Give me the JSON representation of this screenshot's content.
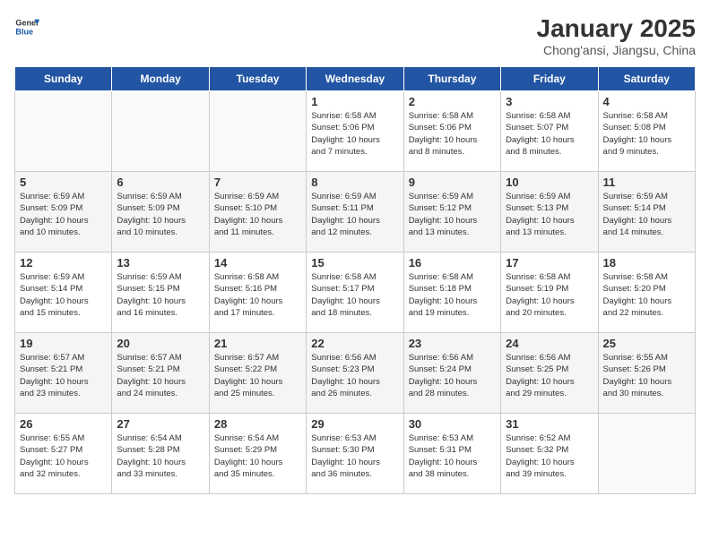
{
  "header": {
    "logo_line1": "General",
    "logo_line2": "Blue",
    "title": "January 2025",
    "subtitle": "Chong'ansi, Jiangsu, China"
  },
  "weekdays": [
    "Sunday",
    "Monday",
    "Tuesday",
    "Wednesday",
    "Thursday",
    "Friday",
    "Saturday"
  ],
  "weeks": [
    [
      {
        "day": "",
        "text": ""
      },
      {
        "day": "",
        "text": ""
      },
      {
        "day": "",
        "text": ""
      },
      {
        "day": "1",
        "text": "Sunrise: 6:58 AM\nSunset: 5:06 PM\nDaylight: 10 hours\nand 7 minutes."
      },
      {
        "day": "2",
        "text": "Sunrise: 6:58 AM\nSunset: 5:06 PM\nDaylight: 10 hours\nand 8 minutes."
      },
      {
        "day": "3",
        "text": "Sunrise: 6:58 AM\nSunset: 5:07 PM\nDaylight: 10 hours\nand 8 minutes."
      },
      {
        "day": "4",
        "text": "Sunrise: 6:58 AM\nSunset: 5:08 PM\nDaylight: 10 hours\nand 9 minutes."
      }
    ],
    [
      {
        "day": "5",
        "text": "Sunrise: 6:59 AM\nSunset: 5:09 PM\nDaylight: 10 hours\nand 10 minutes."
      },
      {
        "day": "6",
        "text": "Sunrise: 6:59 AM\nSunset: 5:09 PM\nDaylight: 10 hours\nand 10 minutes."
      },
      {
        "day": "7",
        "text": "Sunrise: 6:59 AM\nSunset: 5:10 PM\nDaylight: 10 hours\nand 11 minutes."
      },
      {
        "day": "8",
        "text": "Sunrise: 6:59 AM\nSunset: 5:11 PM\nDaylight: 10 hours\nand 12 minutes."
      },
      {
        "day": "9",
        "text": "Sunrise: 6:59 AM\nSunset: 5:12 PM\nDaylight: 10 hours\nand 13 minutes."
      },
      {
        "day": "10",
        "text": "Sunrise: 6:59 AM\nSunset: 5:13 PM\nDaylight: 10 hours\nand 13 minutes."
      },
      {
        "day": "11",
        "text": "Sunrise: 6:59 AM\nSunset: 5:14 PM\nDaylight: 10 hours\nand 14 minutes."
      }
    ],
    [
      {
        "day": "12",
        "text": "Sunrise: 6:59 AM\nSunset: 5:14 PM\nDaylight: 10 hours\nand 15 minutes."
      },
      {
        "day": "13",
        "text": "Sunrise: 6:59 AM\nSunset: 5:15 PM\nDaylight: 10 hours\nand 16 minutes."
      },
      {
        "day": "14",
        "text": "Sunrise: 6:58 AM\nSunset: 5:16 PM\nDaylight: 10 hours\nand 17 minutes."
      },
      {
        "day": "15",
        "text": "Sunrise: 6:58 AM\nSunset: 5:17 PM\nDaylight: 10 hours\nand 18 minutes."
      },
      {
        "day": "16",
        "text": "Sunrise: 6:58 AM\nSunset: 5:18 PM\nDaylight: 10 hours\nand 19 minutes."
      },
      {
        "day": "17",
        "text": "Sunrise: 6:58 AM\nSunset: 5:19 PM\nDaylight: 10 hours\nand 20 minutes."
      },
      {
        "day": "18",
        "text": "Sunrise: 6:58 AM\nSunset: 5:20 PM\nDaylight: 10 hours\nand 22 minutes."
      }
    ],
    [
      {
        "day": "19",
        "text": "Sunrise: 6:57 AM\nSunset: 5:21 PM\nDaylight: 10 hours\nand 23 minutes."
      },
      {
        "day": "20",
        "text": "Sunrise: 6:57 AM\nSunset: 5:21 PM\nDaylight: 10 hours\nand 24 minutes."
      },
      {
        "day": "21",
        "text": "Sunrise: 6:57 AM\nSunset: 5:22 PM\nDaylight: 10 hours\nand 25 minutes."
      },
      {
        "day": "22",
        "text": "Sunrise: 6:56 AM\nSunset: 5:23 PM\nDaylight: 10 hours\nand 26 minutes."
      },
      {
        "day": "23",
        "text": "Sunrise: 6:56 AM\nSunset: 5:24 PM\nDaylight: 10 hours\nand 28 minutes."
      },
      {
        "day": "24",
        "text": "Sunrise: 6:56 AM\nSunset: 5:25 PM\nDaylight: 10 hours\nand 29 minutes."
      },
      {
        "day": "25",
        "text": "Sunrise: 6:55 AM\nSunset: 5:26 PM\nDaylight: 10 hours\nand 30 minutes."
      }
    ],
    [
      {
        "day": "26",
        "text": "Sunrise: 6:55 AM\nSunset: 5:27 PM\nDaylight: 10 hours\nand 32 minutes."
      },
      {
        "day": "27",
        "text": "Sunrise: 6:54 AM\nSunset: 5:28 PM\nDaylight: 10 hours\nand 33 minutes."
      },
      {
        "day": "28",
        "text": "Sunrise: 6:54 AM\nSunset: 5:29 PM\nDaylight: 10 hours\nand 35 minutes."
      },
      {
        "day": "29",
        "text": "Sunrise: 6:53 AM\nSunset: 5:30 PM\nDaylight: 10 hours\nand 36 minutes."
      },
      {
        "day": "30",
        "text": "Sunrise: 6:53 AM\nSunset: 5:31 PM\nDaylight: 10 hours\nand 38 minutes."
      },
      {
        "day": "31",
        "text": "Sunrise: 6:52 AM\nSunset: 5:32 PM\nDaylight: 10 hours\nand 39 minutes."
      },
      {
        "day": "",
        "text": ""
      }
    ]
  ]
}
